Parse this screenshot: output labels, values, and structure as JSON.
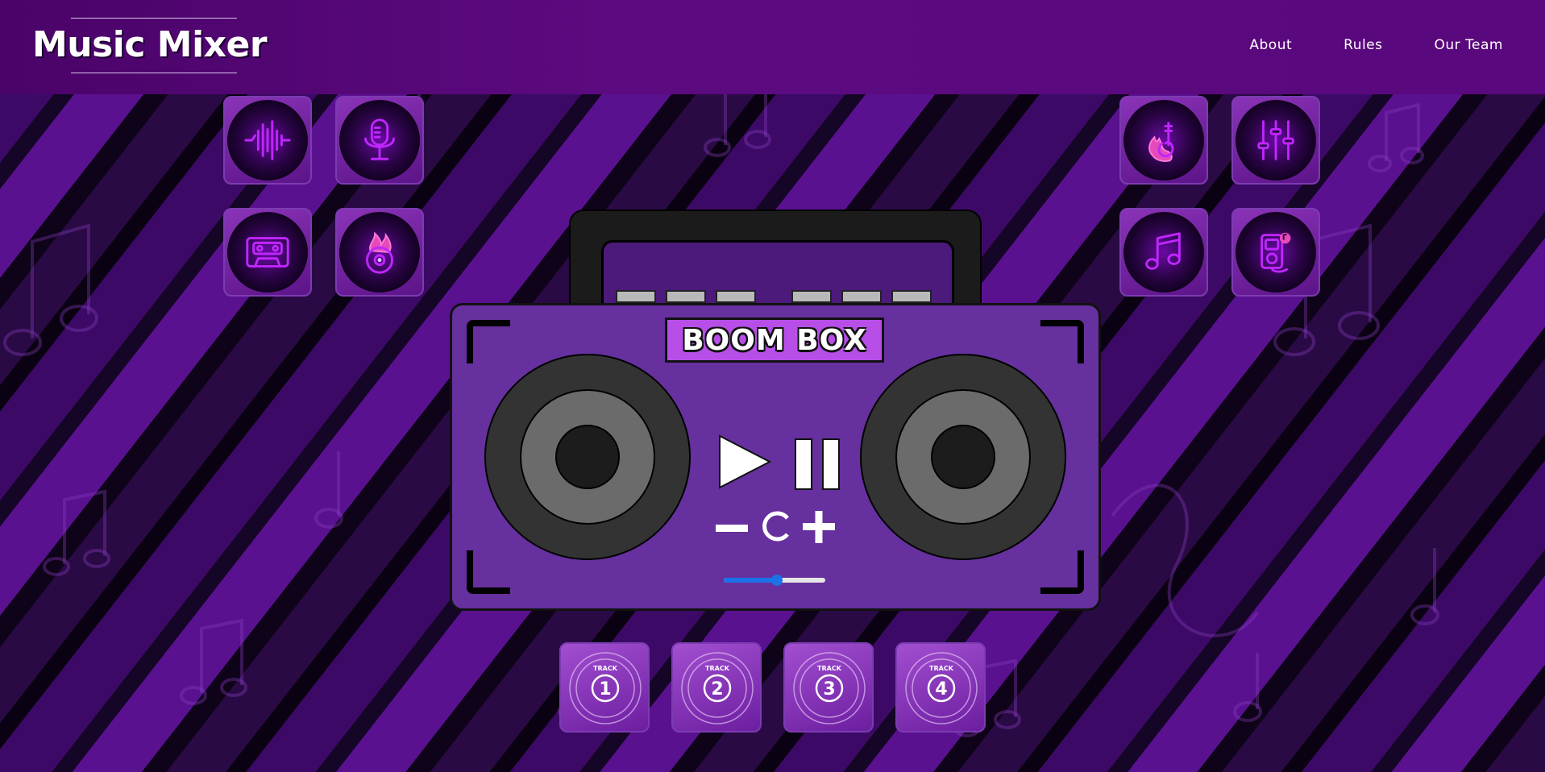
{
  "header": {
    "title": "Music Mixer",
    "nav": [
      {
        "label": "About"
      },
      {
        "label": "Rules"
      },
      {
        "label": "Our Team"
      }
    ]
  },
  "sound_tiles": [
    {
      "icon": "soundwave-icon"
    },
    {
      "icon": "microphone-icon"
    },
    {
      "icon": "cassette-icon"
    },
    {
      "icon": "flaming-record-icon"
    },
    {
      "icon": "flaming-guitar-icon"
    },
    {
      "icon": "equalizer-sliders-icon"
    },
    {
      "icon": "music-note-icon"
    },
    {
      "icon": "music-player-icon"
    }
  ],
  "boombox": {
    "label": "BOOM BOX",
    "controls": {
      "play": "play-icon",
      "pause": "pause-icon",
      "volume_down": "minus-icon",
      "reset": "reload-icon",
      "volume_up": "plus-icon"
    },
    "volume_level": 0.52
  },
  "tracks": [
    {
      "caption": "TRACK",
      "number": "1"
    },
    {
      "caption": "TRACK",
      "number": "2"
    },
    {
      "caption": "TRACK",
      "number": "3"
    },
    {
      "caption": "TRACK",
      "number": "4"
    }
  ],
  "colors": {
    "accent_neon": "#c026ff",
    "header_bg": "#540a78",
    "boombox_body": "#66309e",
    "plate": "#b84ee8",
    "volume_fill": "#1a73e8"
  }
}
